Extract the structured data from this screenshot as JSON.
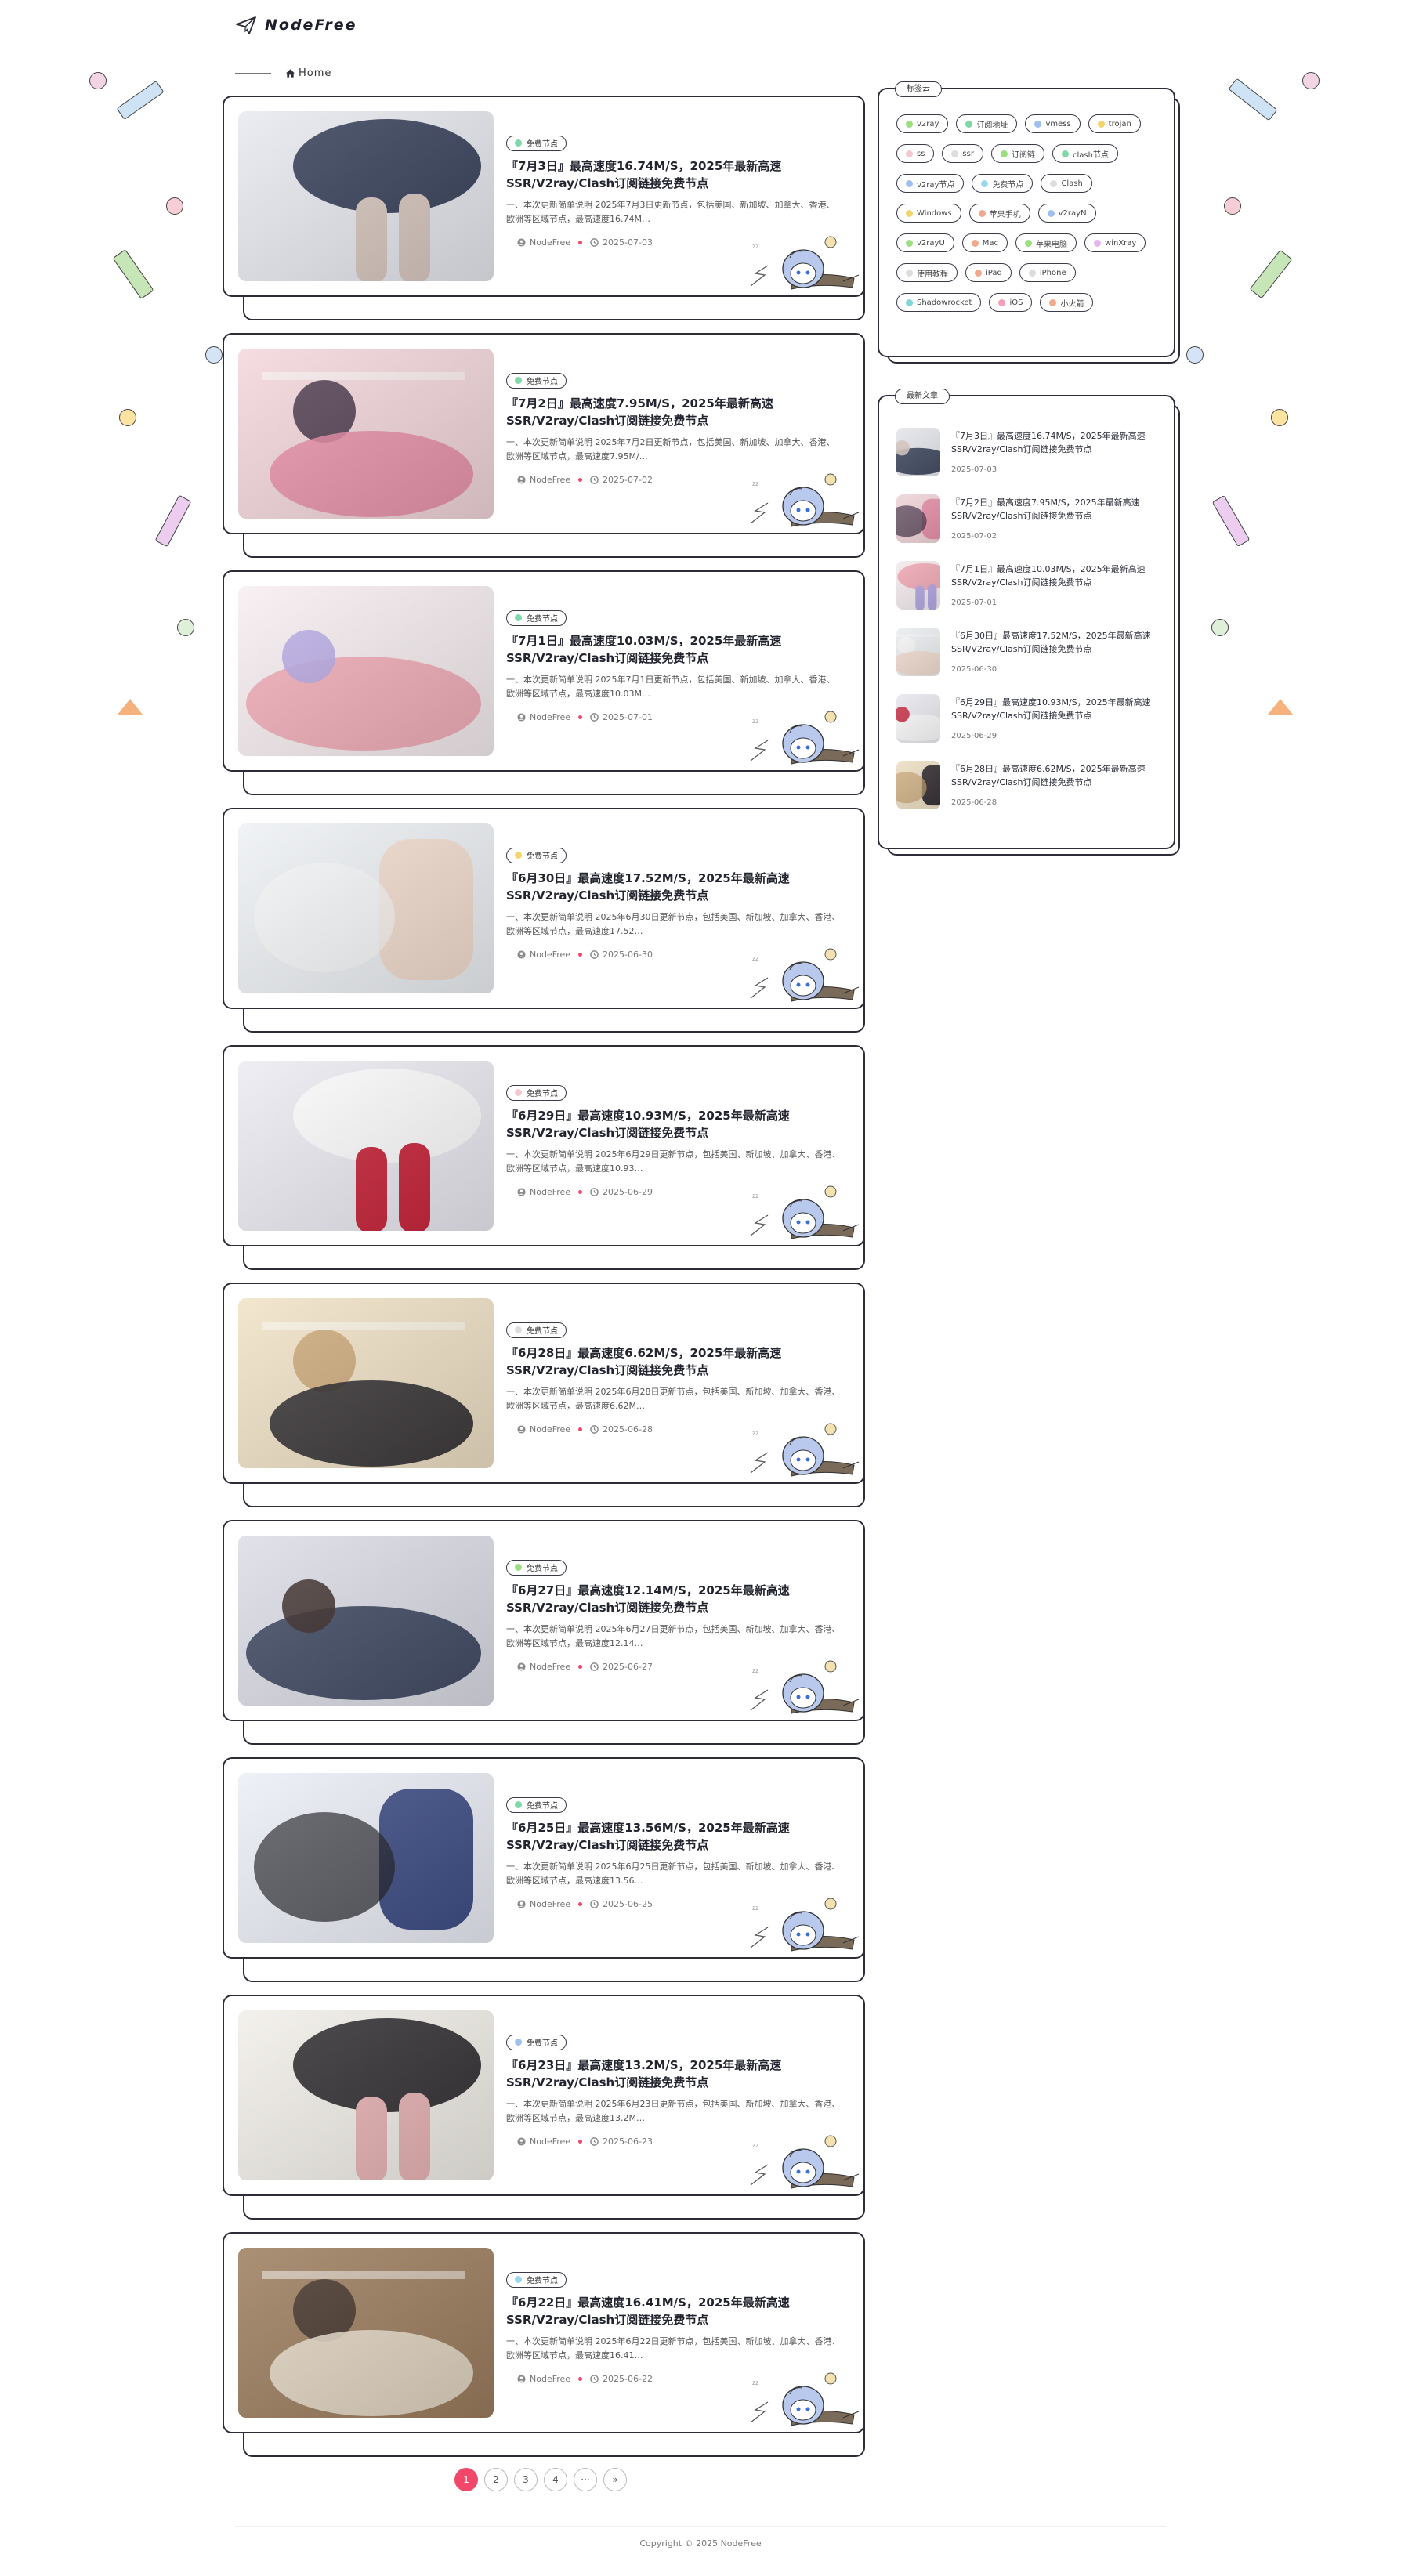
{
  "site": {
    "name": "NodeFree"
  },
  "breadcrumb": {
    "home_label": "Home"
  },
  "posts": [
    {
      "tag": "免费节点",
      "tag_color": "#7ed8a8",
      "title": "『7月3日』最高速度16.74M/S，2025年最新高速SSR/V2ray/Clash订阅链接免费节点",
      "excerpt": "一、本次更新简单说明 2025年7月3日更新节点，包括美国、新加坡、加拿大、香港、欧洲等区域节点，最高速度16.74M…",
      "author": "NodeFree",
      "date": "2025-07-03",
      "thumb": {
        "bg": "#e8e9ef",
        "main": "#26304a",
        "accent": "#d9c9c0"
      }
    },
    {
      "tag": "免费节点",
      "tag_color": "#7ed8a8",
      "title": "『7月2日』最高速度7.95M/S，2025年最新高速SSR/V2ray/Clash订阅链接免费节点",
      "excerpt": "一、本次更新简单说明 2025年7月2日更新节点，包括美国、新加坡、加拿大、香港、欧洲等区域节点，最高速度7.95M/…",
      "author": "NodeFree",
      "date": "2025-07-02",
      "thumb": {
        "bg": "#f3d7dc",
        "main": "#e889a5",
        "accent": "#3b2a3e"
      }
    },
    {
      "tag": "免费节点",
      "tag_color": "#7ed8a8",
      "title": "『7月1日』最高速度10.03M/S，2025年最新高速SSR/V2ray/Clash订阅链接免费节点",
      "excerpt": "一、本次更新简单说明 2025年7月1日更新节点，包括美国、新加坡、加拿大、香港、欧洲等区域节点，最高速度10.03M…",
      "author": "NodeFree",
      "date": "2025-07-01",
      "thumb": {
        "bg": "#f7eef0",
        "main": "#f2a3b1",
        "accent": "#b6a9e6"
      }
    },
    {
      "tag": "免费节点",
      "tag_color": "#f4d56a",
      "title": "『6月30日』最高速度17.52M/S，2025年最新高速SSR/V2ray/Clash订阅链接免费节点",
      "excerpt": "一、本次更新简单说明 2025年6月30日更新节点，包括美国、新加坡、加拿大、香港、欧洲等区域节点，最高速度17.52…",
      "author": "NodeFree",
      "date": "2025-06-30",
      "thumb": {
        "bg": "#eef1f4",
        "main": "#f4dccd",
        "accent": "#fafafa"
      }
    },
    {
      "tag": "免费节点",
      "tag_color": "#f5c7d0",
      "title": "『6月29日』最高速度10.93M/S，2025年最新高速SSR/V2ray/Clash订阅链接免费节点",
      "excerpt": "一、本次更新简单说明 2025年6月29日更新节点，包括美国、新加坡、加拿大、香港、欧洲等区域节点，最高速度10.93…",
      "author": "NodeFree",
      "date": "2025-06-29",
      "thumb": {
        "bg": "#ecebf2",
        "main": "#ffffff",
        "accent": "#c9243a"
      }
    },
    {
      "tag": "免费节点",
      "tag_color": "#dddddd",
      "title": "『6月28日』最高速度6.62M/S，2025年最新高速SSR/V2ray/Clash订阅链接免费节点",
      "excerpt": "一、本次更新简单说明 2025年6月28日更新节点，包括美国、新加坡、加拿大、香港、欧洲等区域节点，最高速度6.62M…",
      "author": "NodeFree",
      "date": "2025-06-28",
      "thumb": {
        "bg": "#f1e2c7",
        "main": "#1f1c22",
        "accent": "#c8a170"
      }
    },
    {
      "tag": "免费节点",
      "tag_color": "#9be07f",
      "title": "『6月27日』最高速度12.14M/S，2025年最新高速SSR/V2ray/Clash订阅链接免费节点",
      "excerpt": "一、本次更新简单说明 2025年6月27日更新节点，包括美国、新加坡、加拿大、香港、欧洲等区域节点，最高速度12.14…",
      "author": "NodeFree",
      "date": "2025-06-27",
      "thumb": {
        "bg": "#dcdde6",
        "main": "#28324d",
        "accent": "#3a2a28"
      }
    },
    {
      "tag": "免费节点",
      "tag_color": "#7ed8a8",
      "title": "『6月25日』最高速度13.56M/S，2025年最新高速SSR/V2ray/Clash订阅链接免费节点",
      "excerpt": "一、本次更新简单说明 2025年6月25日更新节点，包括美国、新加坡、加拿大、香港、欧洲等区域节点，最高速度13.56…",
      "author": "NodeFree",
      "date": "2025-06-25",
      "thumb": {
        "bg": "#eceef7",
        "main": "#2a3b78",
        "accent": "#1a1a1f"
      }
    },
    {
      "tag": "免费节点",
      "tag_color": "#9fc0ef",
      "title": "『6月23日』最高速度13.2M/S，2025年最新高速SSR/V2ray/Clash订阅链接免费节点",
      "excerpt": "一、本次更新简单说明 2025年6月23日更新节点，包括美国、新加坡、加拿大、香港、欧洲等区域节点，最高速度13.2M…",
      "author": "NodeFree",
      "date": "2025-06-23",
      "thumb": {
        "bg": "#f2efe9",
        "main": "#1e1b1f",
        "accent": "#e8b3b5"
      }
    },
    {
      "tag": "免费节点",
      "tag_color": "#9ad7ef",
      "title": "『6月22日』最高速度16.41M/S，2025年最新高速SSR/V2ray/Clash订阅链接免费节点",
      "excerpt": "一、本次更新简单说明 2025年6月22日更新节点，包括美国、新加坡、加拿大、香港、欧洲等区域节点，最高速度16.41…",
      "author": "NodeFree",
      "date": "2025-06-22",
      "thumb": {
        "bg": "#9c7d5e",
        "main": "#efe3d2",
        "accent": "#3a2a24"
      }
    }
  ],
  "sidebar": {
    "tags_title": "标签云",
    "tags": [
      {
        "label": "v2ray",
        "color": "#9be07f"
      },
      {
        "label": "订阅地址",
        "color": "#7ed8a8"
      },
      {
        "label": "vmess",
        "color": "#9fc0ef"
      },
      {
        "label": "trojan",
        "color": "#f4d56a"
      },
      {
        "label": "ss",
        "color": "#f5c7d0"
      },
      {
        "label": "ssr",
        "color": "#dddddd"
      },
      {
        "label": "订阅链",
        "color": "#9be07f"
      },
      {
        "label": "clash节点",
        "color": "#7ed8a8"
      },
      {
        "label": "v2ray节点",
        "color": "#9fc0ef"
      },
      {
        "label": "免费节点",
        "color": "#9ad7ef"
      },
      {
        "label": "Clash",
        "color": "#dddddd"
      },
      {
        "label": "Windows",
        "color": "#f4d56a"
      },
      {
        "label": "苹果手机",
        "color": "#f2a88c"
      },
      {
        "label": "v2rayN",
        "color": "#9fc0ef"
      },
      {
        "label": "v2rayU",
        "color": "#9be07f"
      },
      {
        "label": "Mac",
        "color": "#f2a88c"
      },
      {
        "label": "苹果电脑",
        "color": "#9be07f"
      },
      {
        "label": "winXray",
        "color": "#e4b6ef"
      },
      {
        "label": "使用教程",
        "color": "#dddddd"
      },
      {
        "label": "iPad",
        "color": "#f2a88c"
      },
      {
        "label": "iPhone",
        "color": "#dddddd"
      },
      {
        "label": "Shadowrocket",
        "color": "#7ed8d8"
      },
      {
        "label": "iOS",
        "color": "#f5a0b8"
      },
      {
        "label": "小火箭",
        "color": "#f2a88c"
      }
    ],
    "recent_title": "最新文章",
    "recent": [
      {
        "title": "『7月3日』最高速度16.74M/S，2025年最新高速SSR/V2ray/Clash订阅链接免费节点",
        "date": "2025-07-03"
      },
      {
        "title": "『7月2日』最高速度7.95M/S，2025年最新高速SSR/V2ray/Clash订阅链接免费节点",
        "date": "2025-07-02"
      },
      {
        "title": "『7月1日』最高速度10.03M/S，2025年最新高速SSR/V2ray/Clash订阅链接免费节点",
        "date": "2025-07-01"
      },
      {
        "title": "『6月30日』最高速度17.52M/S，2025年最新高速SSR/V2ray/Clash订阅链接免费节点",
        "date": "2025-06-30"
      },
      {
        "title": "『6月29日』最高速度10.93M/S，2025年最新高速SSR/V2ray/Clash订阅链接免费节点",
        "date": "2025-06-29"
      },
      {
        "title": "『6月28日』最高速度6.62M/S，2025年最新高速SSR/V2ray/Clash订阅链接免费节点",
        "date": "2025-06-28"
      }
    ]
  },
  "pagination": {
    "pages": [
      "1",
      "2",
      "3",
      "4",
      "···",
      "»"
    ],
    "active": "1",
    "active_color": "#f0476a"
  },
  "footer": {
    "copyright": "Copyright © 2025 NodeFree"
  }
}
